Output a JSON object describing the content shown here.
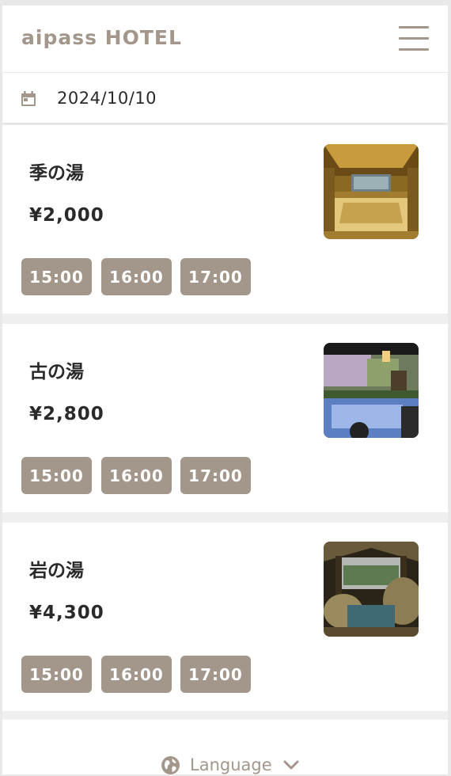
{
  "header": {
    "brand": "aipass HOTEL",
    "menu_icon": "hamburger-menu-icon"
  },
  "datebar": {
    "icon": "calendar-icon",
    "date": "2024/10/10"
  },
  "cards": [
    {
      "name": "季の湯",
      "price": "¥2,000",
      "slots": [
        "15:00",
        "16:00",
        "17:00"
      ]
    },
    {
      "name": "古の湯",
      "price": "¥2,800",
      "slots": [
        "15:00",
        "16:00",
        "17:00"
      ]
    },
    {
      "name": "岩の湯",
      "price": "¥4,300",
      "slots": [
        "15:00",
        "16:00",
        "17:00"
      ]
    }
  ],
  "footer": {
    "language_label": "Language",
    "icon": "globe-icon",
    "chevron": "chevron-down-icon"
  },
  "colors": {
    "accent": "#a3968a",
    "text": "#2a2a2a",
    "background": "#efefef"
  }
}
